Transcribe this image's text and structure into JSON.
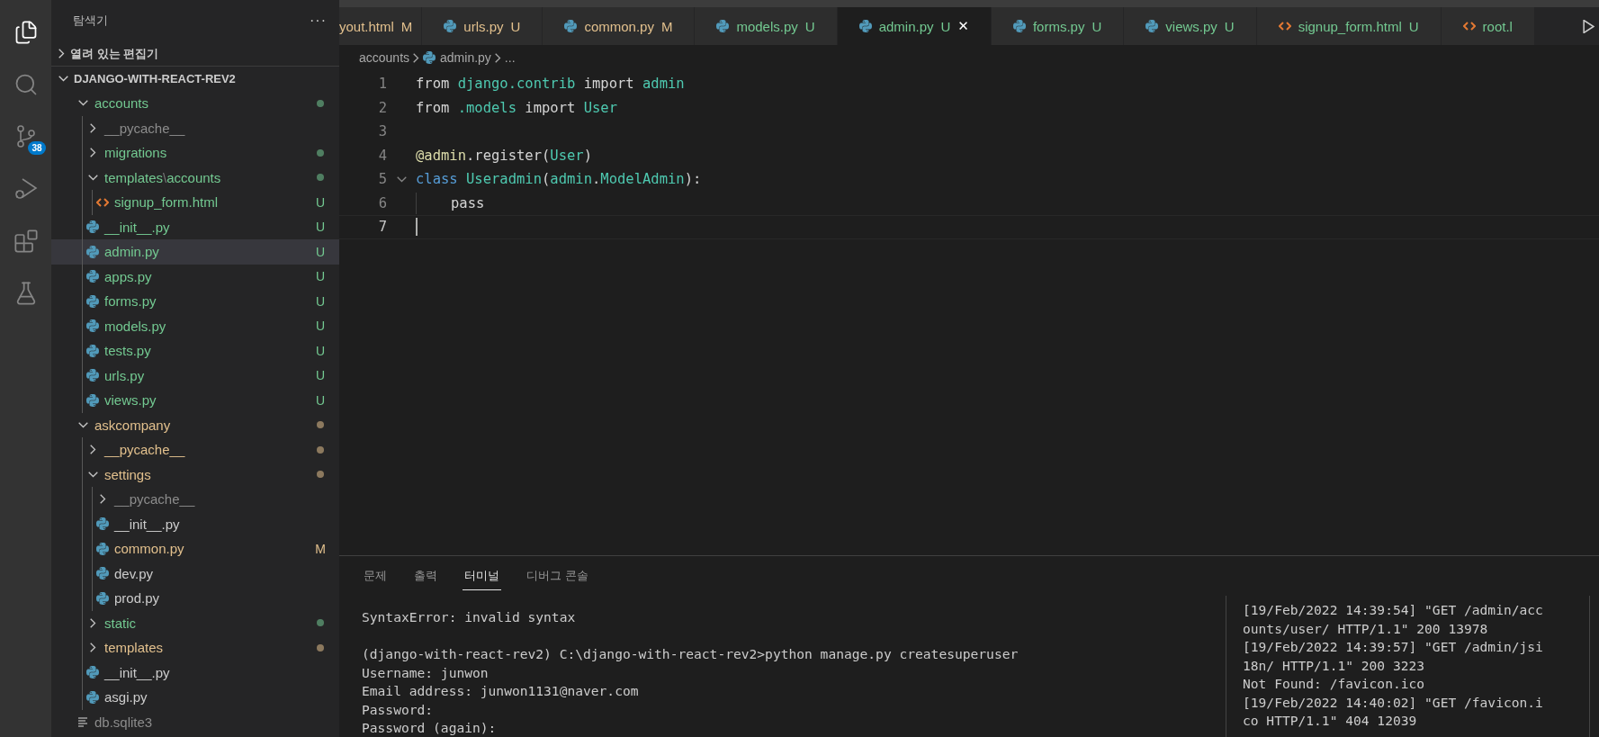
{
  "activity_bar": {
    "items": [
      {
        "kind": "files",
        "selected": true
      },
      {
        "kind": "search",
        "selected": false
      },
      {
        "kind": "source-control",
        "selected": false,
        "badge": "38"
      },
      {
        "kind": "run-debug",
        "selected": false
      },
      {
        "kind": "extensions",
        "selected": false
      },
      {
        "kind": "testing",
        "selected": false
      }
    ]
  },
  "sidebar": {
    "title": "탐색기",
    "more": "···",
    "open_editors": {
      "label": "열려 있는 편집기",
      "expanded": false
    },
    "project": {
      "label": "DJANGO-WITH-REACT-REV2",
      "expanded": true,
      "children": [
        {
          "name": "accounts",
          "kind": "folder",
          "expanded": true,
          "color": "#73c991",
          "dot": true,
          "children": [
            {
              "name": "__pycache__",
              "kind": "folder",
              "expanded": false,
              "color": "#8c8c8c"
            },
            {
              "name": "migrations",
              "kind": "folder",
              "expanded": false,
              "color": "#73c991",
              "dot": true
            },
            {
              "name": "templates",
              "separator": "\\",
              "sub": "accounts",
              "kind": "folder",
              "expanded": true,
              "color": "#73c991",
              "dot": true,
              "children": [
                {
                  "name": "signup_form.html",
                  "kind": "html",
                  "color": "#73c991",
                  "badge": "U",
                  "selected": false
                }
              ]
            },
            {
              "name": "__init__.py",
              "kind": "python",
              "color": "#73c991",
              "badge": "U",
              "selected": false
            },
            {
              "name": "admin.py",
              "kind": "python",
              "color": "#73c991",
              "badge": "U",
              "selected": true
            },
            {
              "name": "apps.py",
              "kind": "python",
              "color": "#73c991",
              "badge": "U",
              "selected": false
            },
            {
              "name": "forms.py",
              "kind": "python",
              "color": "#73c991",
              "badge": "U",
              "selected": false
            },
            {
              "name": "models.py",
              "kind": "python",
              "color": "#73c991",
              "badge": "U",
              "selected": false
            },
            {
              "name": "tests.py",
              "kind": "python",
              "color": "#73c991",
              "badge": "U",
              "selected": false
            },
            {
              "name": "urls.py",
              "kind": "python",
              "color": "#73c991",
              "badge": "U",
              "selected": false
            },
            {
              "name": "views.py",
              "kind": "python",
              "color": "#73c991",
              "badge": "U",
              "selected": false
            }
          ]
        },
        {
          "name": "askcompany",
          "kind": "folder",
          "expanded": true,
          "color": "#e2c08d",
          "dot": true,
          "children": [
            {
              "name": "__pycache__",
              "kind": "folder",
              "expanded": false,
              "color": "#e2c08d",
              "dot": true
            },
            {
              "name": "settings",
              "kind": "folder",
              "expanded": true,
              "color": "#e2c08d",
              "dot": true,
              "children": [
                {
                  "name": "__pycache__",
                  "kind": "folder",
                  "expanded": false,
                  "color": "#8c8c8c"
                },
                {
                  "name": "__init__.py",
                  "kind": "python",
                  "color": "#cccccc",
                  "selected": false
                },
                {
                  "name": "common.py",
                  "kind": "python",
                  "color": "#e2c08d",
                  "badge": "M",
                  "selected": false
                },
                {
                  "name": "dev.py",
                  "kind": "python",
                  "color": "#cccccc",
                  "selected": false
                },
                {
                  "name": "prod.py",
                  "kind": "python",
                  "color": "#cccccc",
                  "selected": false
                }
              ]
            },
            {
              "name": "static",
              "kind": "folder",
              "expanded": false,
              "color": "#73c991",
              "dot": true
            },
            {
              "name": "templates",
              "kind": "folder",
              "expanded": false,
              "color": "#e2c08d",
              "dot": true
            },
            {
              "name": "__init__.py",
              "kind": "python",
              "color": "#cccccc",
              "selected": false
            },
            {
              "name": "asgi.py",
              "kind": "python",
              "color": "#cccccc",
              "selected": false
            }
          ]
        },
        {
          "name": "db.sqlite3",
          "kind": "text",
          "color": "#8c8c8c",
          "selected": false
        }
      ]
    }
  },
  "tabs": [
    {
      "label": "yout.html",
      "badge": "M",
      "kind": "none",
      "color": "#e2c08d",
      "selected": false
    },
    {
      "label": "urls.py",
      "badge": "U",
      "kind": "python",
      "color": "#e2c08d",
      "selected": false
    },
    {
      "label": "common.py",
      "badge": "M",
      "kind": "python",
      "color": "#e2c08d",
      "selected": false
    },
    {
      "label": "models.py",
      "badge": "U",
      "kind": "python",
      "color": "#73c991",
      "selected": false
    },
    {
      "label": "admin.py",
      "badge": "U",
      "kind": "python",
      "color": "#73c991",
      "selected": true,
      "close": "✕"
    },
    {
      "label": "forms.py",
      "badge": "U",
      "kind": "python",
      "color": "#73c991",
      "selected": false
    },
    {
      "label": "views.py",
      "badge": "U",
      "kind": "python",
      "color": "#73c991",
      "selected": false
    },
    {
      "label": "signup_form.html",
      "badge": "U",
      "kind": "html",
      "color": "#73c991",
      "selected": false
    },
    {
      "label": "root.l",
      "kind": "html",
      "color": "#73c991",
      "selected": false
    }
  ],
  "breadcrumb": [
    {
      "label": "accounts",
      "kind": "folder"
    },
    {
      "label": "admin.py",
      "kind": "python"
    },
    {
      "label": "...",
      "kind": "more"
    }
  ],
  "editor": {
    "lines": [
      {
        "number": "1",
        "tokens": [
          {
            "t": "from "
          },
          {
            "t": "django.contrib",
            "color": "#4ec9b0"
          },
          {
            "t": " import "
          },
          {
            "t": "admin",
            "color": "#4ec9b0"
          }
        ]
      },
      {
        "number": "2",
        "tokens": [
          {
            "t": "from "
          },
          {
            "t": ".models",
            "color": "#4ec9b0"
          },
          {
            "t": " import "
          },
          {
            "t": "User",
            "color": "#4ec9b0"
          }
        ]
      },
      {
        "number": "3"
      },
      {
        "number": "4",
        "tokens": [
          {
            "t": "@admin",
            "color": "#dcdcaa"
          },
          {
            "t": ".register("
          },
          {
            "t": "User",
            "color": "#4ec9b0"
          },
          {
            "t": ")"
          }
        ]
      },
      {
        "number": "5",
        "fold": true,
        "tokens": [
          {
            "t": "class ",
            "color": "#569cd6"
          },
          {
            "t": "Useradmin",
            "color": "#4ec9b0"
          },
          {
            "t": "("
          },
          {
            "t": "admin",
            "color": "#4ec9b0"
          },
          {
            "t": "."
          },
          {
            "t": "ModelAdmin",
            "color": "#4ec9b0"
          },
          {
            "t": "):"
          }
        ]
      },
      {
        "number": "6",
        "indent": true,
        "tokens": [
          {
            "t": "pass"
          }
        ]
      },
      {
        "number": "7",
        "current": true
      }
    ]
  },
  "panel": {
    "tabs": [
      {
        "label": "문제",
        "selected": false
      },
      {
        "label": "출력",
        "selected": false
      },
      {
        "label": "터미널",
        "selected": true
      },
      {
        "label": "디버그 콘솔",
        "selected": false
      }
    ],
    "terminal": [
      [
        "SyntaxError: invalid syntax"
      ],
      [
        "(django-with-react-rev2) C:\\django-with-react-rev2>python manage.py createsuperuser",
        "Username: junwon",
        "Email address: junwon1131@naver.com",
        "Password:",
        "Password (again):"
      ]
    ],
    "terminal_2": [
      "[19/Feb/2022 14:39:54] \"GET /admin/acc",
      "ounts/user/ HTTP/1.1\" 200 13978",
      "[19/Feb/2022 14:39:57] \"GET /admin/jsi",
      "18n/ HTTP/1.1\" 200 3223",
      "Not Found: /favicon.ico",
      "[19/Feb/2022 14:40:02] \"GET /favicon.i",
      "co HTTP/1.1\" 404 12039"
    ]
  }
}
